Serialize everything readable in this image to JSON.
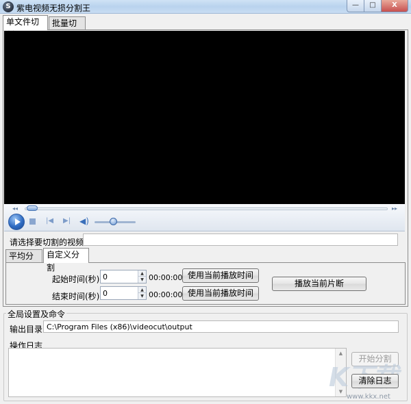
{
  "window": {
    "title": "紫电视频无损分割王",
    "icon": "film-icon",
    "min_label": "—",
    "max_label": "□",
    "close_label": "X"
  },
  "tabs": [
    {
      "label": "单文件切割",
      "active": true
    },
    {
      "label": "批量切割",
      "active": false
    }
  ],
  "player": {
    "seek_position": 0.02,
    "volume_level": 0.45
  },
  "file_row": {
    "label": "请选择要切割的视频:",
    "value": ""
  },
  "sub_tabs": [
    {
      "label": "平均分割",
      "active": false
    },
    {
      "label": "自定义分割",
      "active": true
    }
  ],
  "custom_split": {
    "start_label": "起始时间(秒):",
    "start_value": "0",
    "start_time": "00:00:00",
    "end_label": "结束时间(秒):",
    "end_value": "0",
    "end_time": "00:00:00",
    "use_current_label": "使用当前播放时间",
    "play_segment_label": "播放当前片断"
  },
  "global": {
    "title": "全局设置及命令",
    "output_label": "输出目录:",
    "output_value": "C:\\Program Files (x86)\\videocut\\output",
    "log_label": "操作日志",
    "start_button": "开始分割",
    "clear_button": "清除日志"
  },
  "watermark": {
    "url": "www.kkx.net"
  }
}
